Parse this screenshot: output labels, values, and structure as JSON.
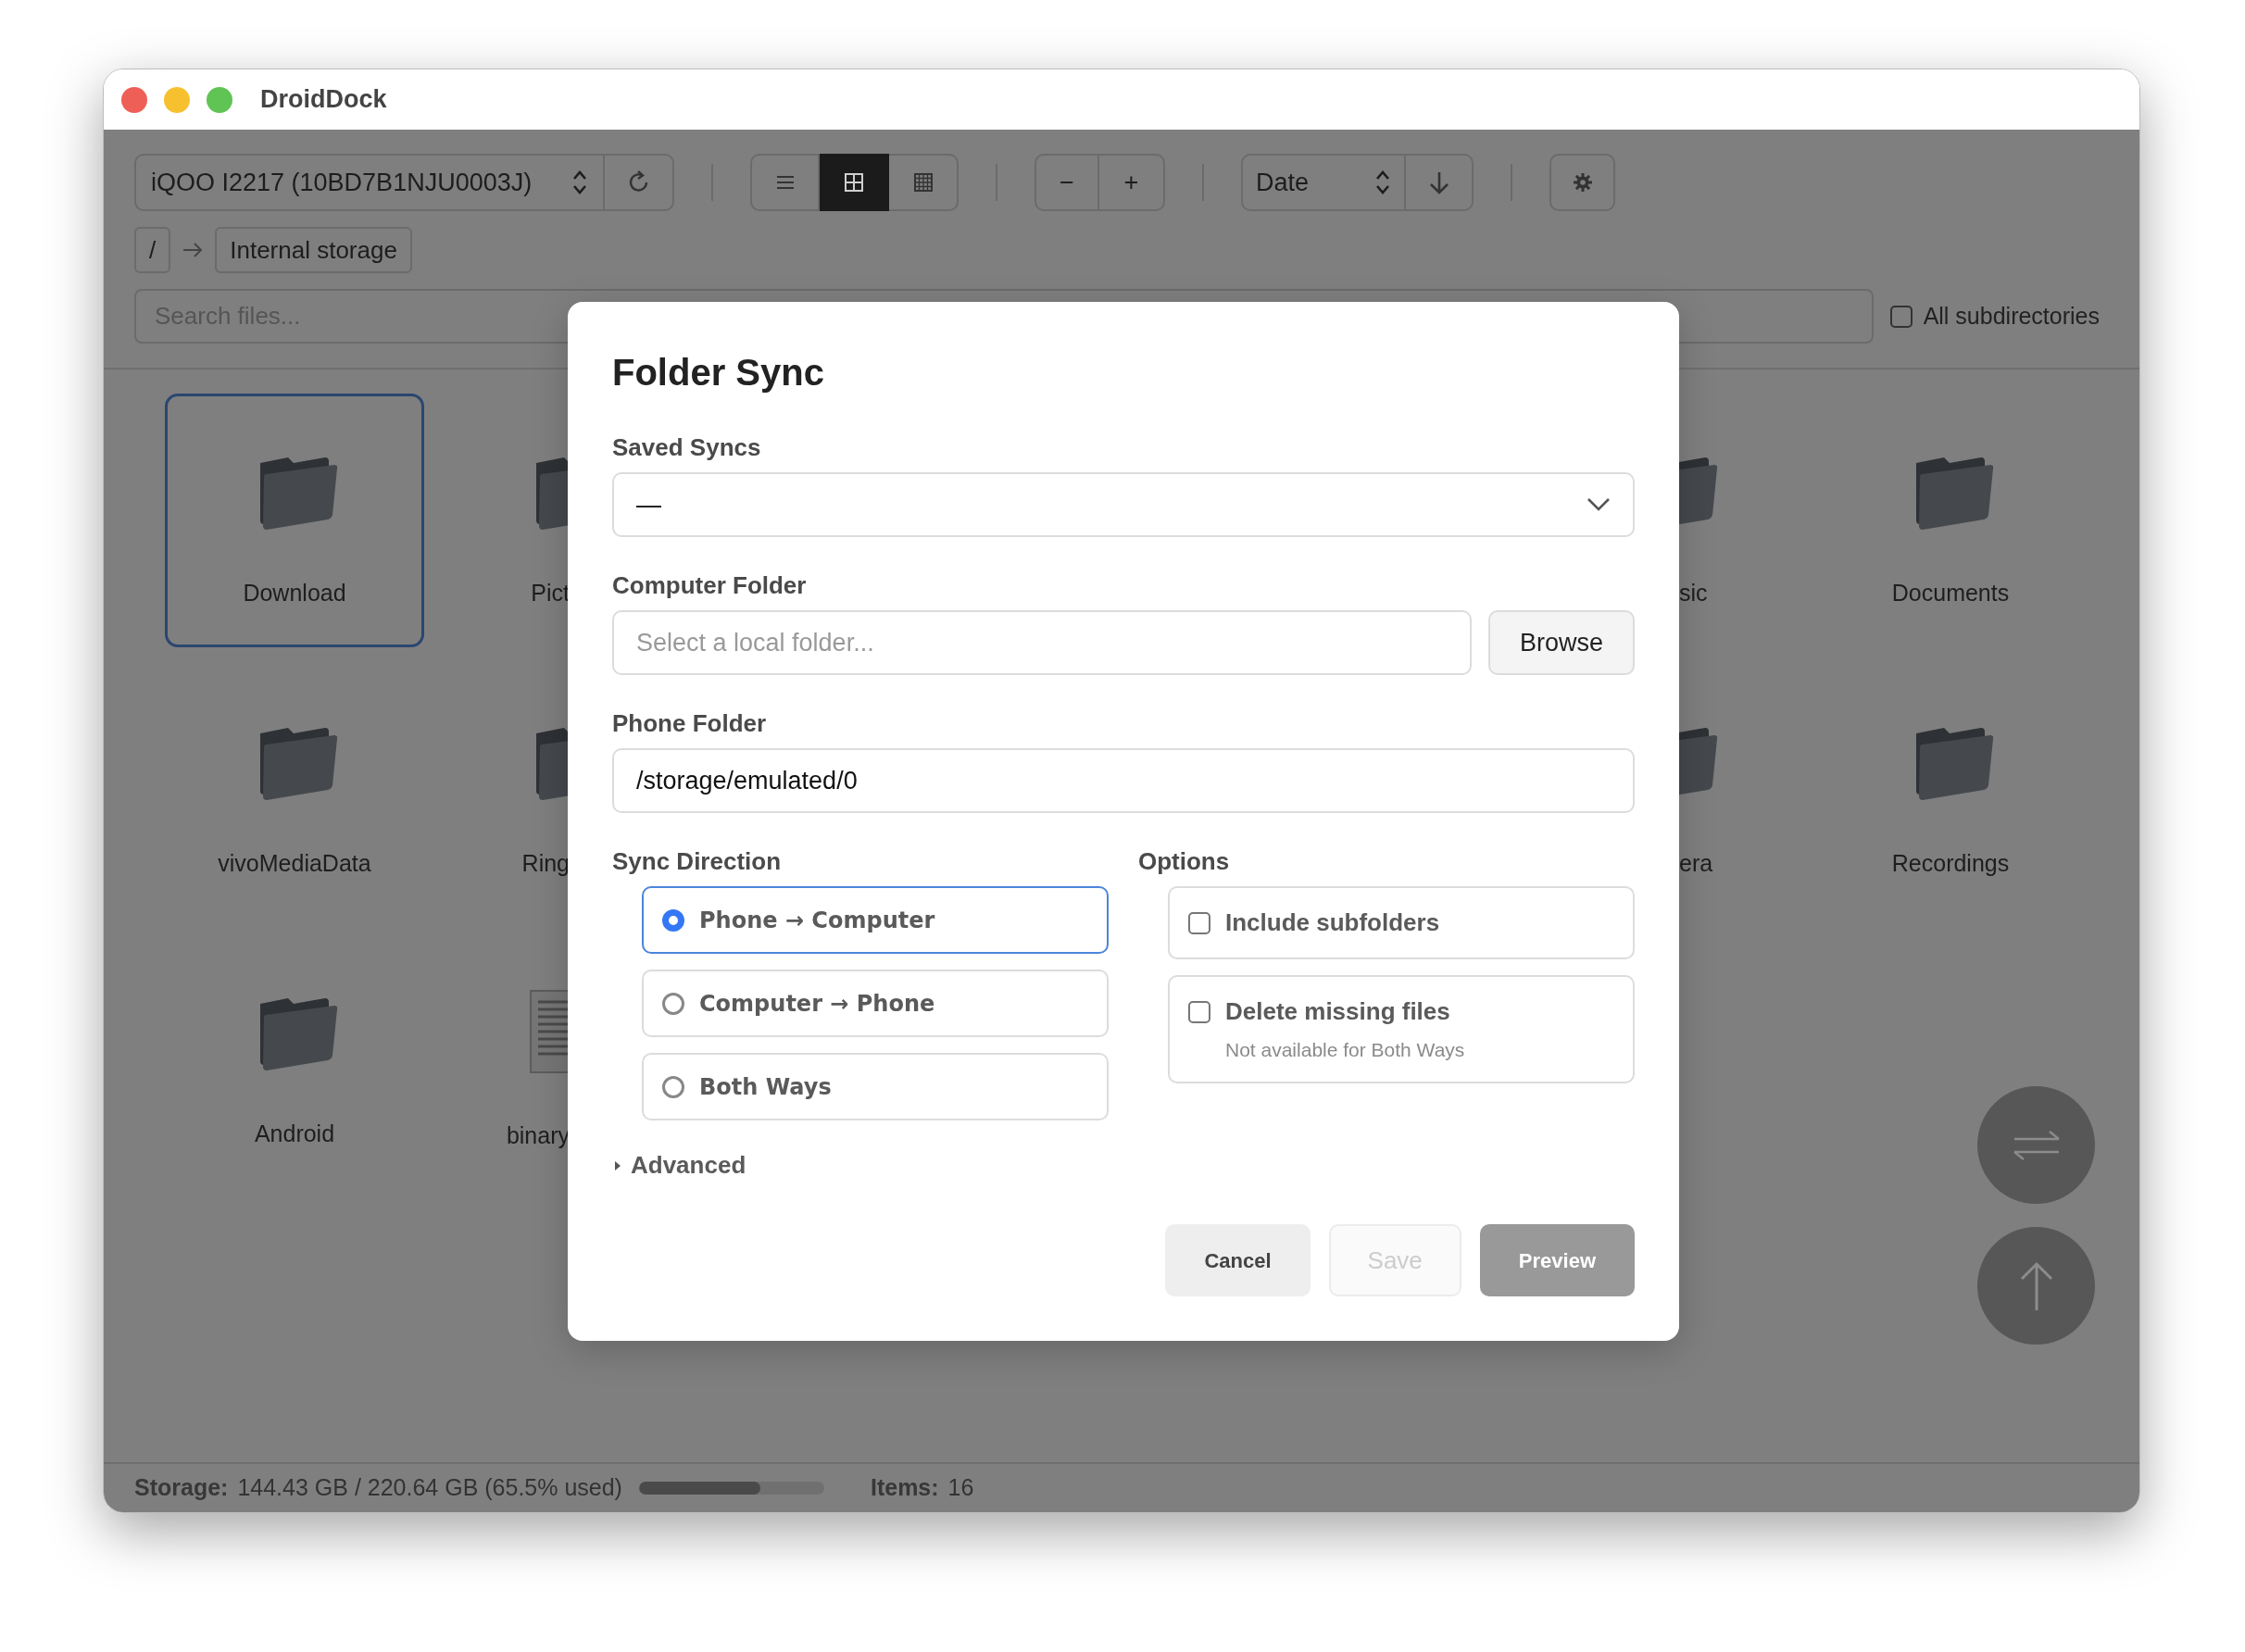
{
  "window": {
    "title": "DroidDock"
  },
  "toolbar": {
    "device": "iQOO I2217 (10BD7B1NJU0003J)",
    "view_modes": [
      {
        "kind": "list",
        "selected": false
      },
      {
        "kind": "grid",
        "selected": true
      },
      {
        "kind": "dense",
        "selected": false
      }
    ],
    "zoom_out": "−",
    "zoom_in": "+",
    "sort": "Date"
  },
  "breadcrumb": {
    "root": "/",
    "items": [
      "Internal storage"
    ]
  },
  "search": {
    "placeholder": "Search files...",
    "all_subdirectories": {
      "label": "All subdirectories",
      "checked": false
    }
  },
  "file_rows": [
    {
      "left": [
        {
          "name": "Download",
          "kind": "folder",
          "selected": true
        },
        {
          "name": "Pict",
          "kind": "folder",
          "selected": false
        }
      ],
      "right": [
        {
          "name": "sic",
          "kind": "folder",
          "selected": false
        },
        {
          "name": "Documents",
          "kind": "folder",
          "selected": false
        }
      ]
    },
    {
      "left": [
        {
          "name": "vivoMediaData",
          "kind": "folder",
          "selected": false
        },
        {
          "name": "Ring",
          "kind": "folder",
          "selected": false
        }
      ],
      "right": [
        {
          "name": "era",
          "kind": "folder",
          "selected": false
        },
        {
          "name": "Recordings",
          "kind": "folder",
          "selected": false
        }
      ]
    },
    {
      "left": [
        {
          "name": "Android",
          "kind": "folder",
          "selected": false
        },
        {
          "name": "binary",
          "kind": "document",
          "selected": false
        }
      ],
      "right": []
    }
  ],
  "status_bar": {
    "storage_label": "Storage:",
    "storage_value": "144.43 GB / 220.64 GB (65.5% used)",
    "level": 0.655,
    "items_label": "Items:",
    "items_value": "16"
  },
  "dialog": {
    "title": "Folder Sync",
    "saved_syncs": {
      "label": "Saved Syncs",
      "value": "—"
    },
    "computer_folder": {
      "label": "Computer Folder",
      "placeholder": "Select a local folder...",
      "button": "Browse"
    },
    "phone_folder": {
      "label": "Phone Folder",
      "value": "/storage/emulated/0"
    },
    "sync_direction": {
      "label": "Sync Direction",
      "options": [
        {
          "label": "Phone → Computer",
          "selected": true
        },
        {
          "label": "Computer → Phone",
          "selected": false
        },
        {
          "label": "Both Ways",
          "selected": false
        }
      ]
    },
    "options": {
      "label": "Options",
      "items": [
        {
          "label": "Include subfolders",
          "checked": false
        },
        {
          "label": "Delete missing files",
          "hint": "Not available for Both Ways",
          "checked": false
        }
      ]
    },
    "advanced": {
      "label": "Advanced",
      "expanded": false
    },
    "buttons": [
      {
        "label": "Cancel",
        "kind": "secondary",
        "disabled": false
      },
      {
        "label": "Save",
        "kind": "secondary",
        "disabled": true
      },
      {
        "label": "Preview",
        "kind": "primary",
        "disabled": false
      }
    ]
  }
}
